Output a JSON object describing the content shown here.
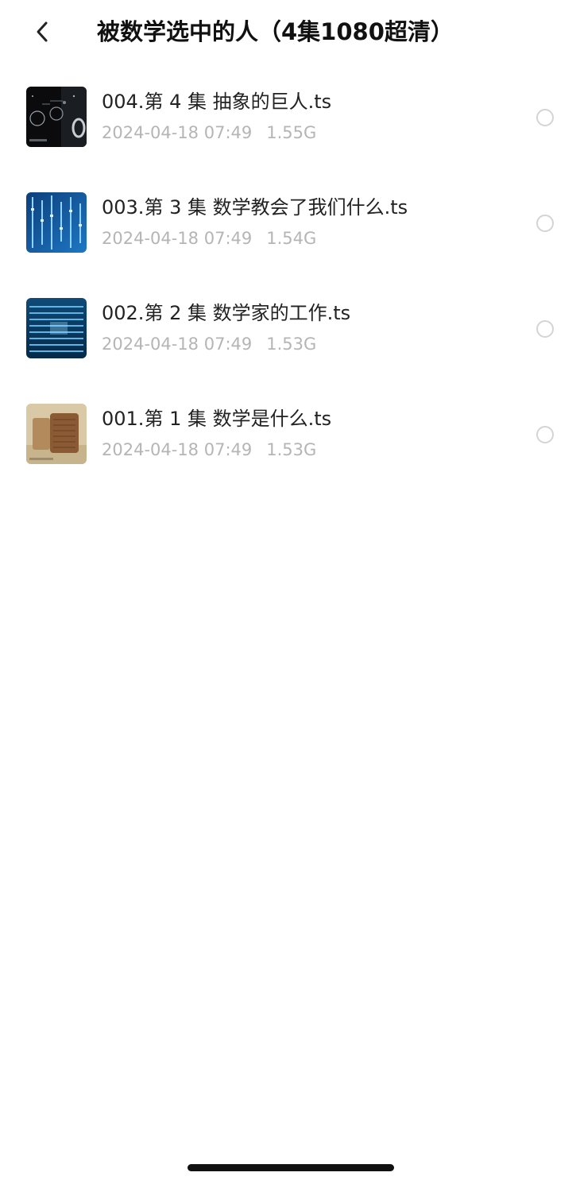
{
  "header": {
    "back_icon": "chevron-left-icon",
    "title": "被数学选中的人（4集1080超清）"
  },
  "files": [
    {
      "name": "004.第 4 集  抽象的巨人.ts",
      "date": "2024-04-18 07:49",
      "size": "1.55G",
      "thumbnail": "dark-space-diagram-thumbnail",
      "selected": false
    },
    {
      "name": "003.第 3 集  数学教会了我们什么.ts",
      "date": "2024-04-18 07:49",
      "size": "1.54G",
      "thumbnail": "blue-binary-code-thumbnail",
      "selected": false
    },
    {
      "name": "002.第 2 集  数学家的工作.ts",
      "date": "2024-04-18 07:49",
      "size": "1.53G",
      "thumbnail": "blue-digits-thumbnail",
      "selected": false
    },
    {
      "name": "001.第 1 集  数学是什么.ts",
      "date": "2024-04-18 07:49",
      "size": "1.53G",
      "thumbnail": "clay-tablet-thumbnail",
      "selected": false
    }
  ],
  "colors": {
    "background": "#ffffff",
    "title_text": "#111111",
    "file_name_text": "#222222",
    "meta_text": "#b5b5b5",
    "radio_border": "#d4d4d4",
    "home_indicator": "#111111"
  }
}
